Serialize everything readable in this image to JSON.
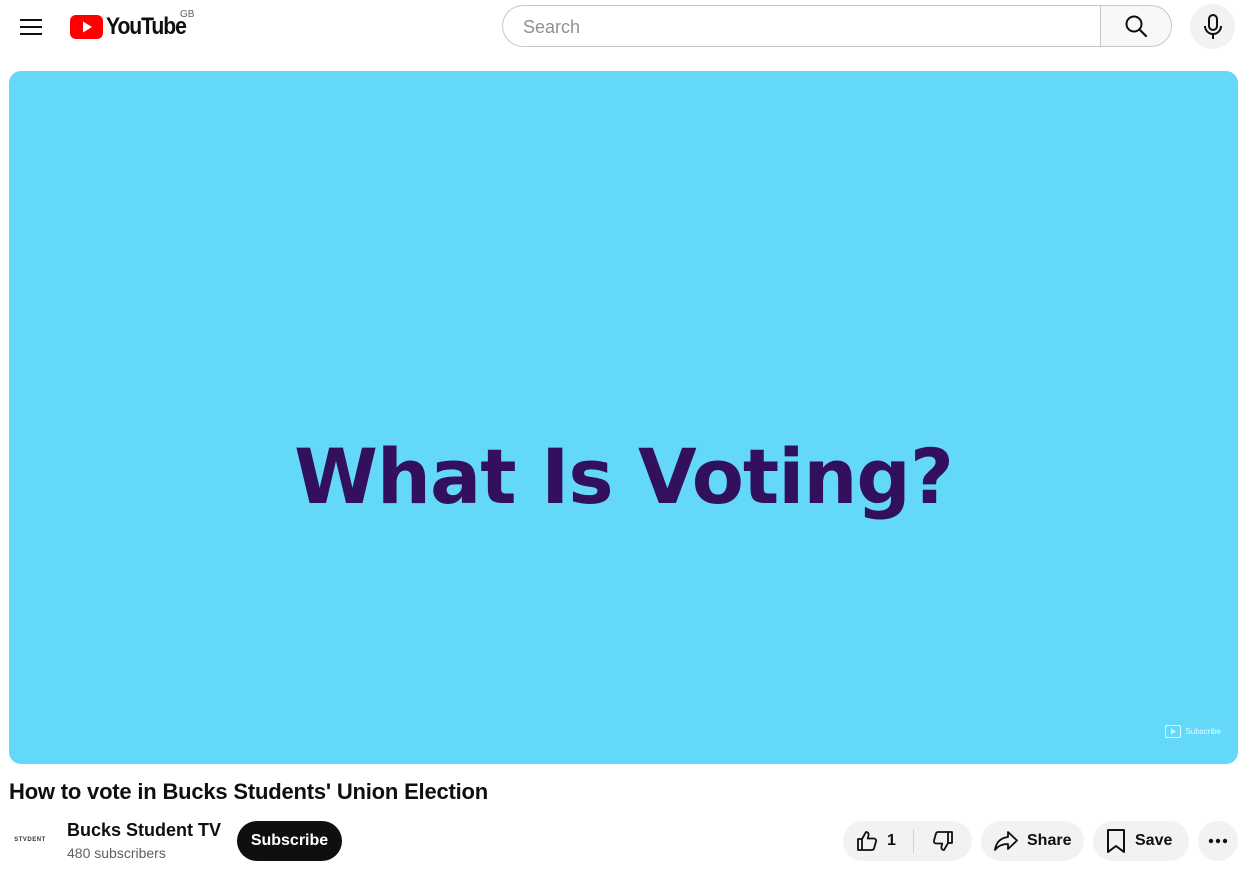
{
  "header": {
    "logo_text": "YouTube",
    "region": "GB",
    "search_placeholder": "Search",
    "search_value": ""
  },
  "player": {
    "heading": "What Is Voting?",
    "watermark_text": "Subscribe"
  },
  "video": {
    "title": "How to vote in Bucks Students' Union Election"
  },
  "channel": {
    "avatar_text": "STVDENT",
    "name": "Bucks Student TV",
    "subscribers": "480 subscribers",
    "subscribe_label": "Subscribe"
  },
  "actions": {
    "like_count": "1",
    "share_label": "Share",
    "save_label": "Save"
  },
  "icons": {
    "menu": "hamburger-menu-icon",
    "logo": "youtube-logo-icon",
    "search": "search-icon",
    "mic": "microphone-icon",
    "like": "thumbs-up-icon",
    "dislike": "thumbs-down-icon",
    "share": "share-arrow-icon",
    "save": "bookmark-icon",
    "more": "more-horizontal-icon"
  },
  "colors": {
    "brand_red": "#ff0000",
    "player_background": "#63d8f9",
    "heading_purple": "#32105e",
    "subscribe_button": "#0f0f0f",
    "pill_background": "#f2f2f2"
  }
}
